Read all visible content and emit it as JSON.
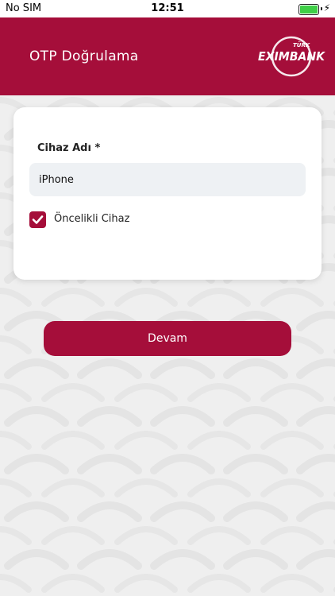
{
  "status_bar": {
    "carrier": "No SIM",
    "time": "12:51",
    "battery_icon": "battery-full-icon",
    "charging_icon": "bolt-icon"
  },
  "header": {
    "title": "OTP Doğrulama",
    "logo_text_top": "TÜRK",
    "logo_text_main": "EXIMBANK",
    "background_color": "#a50e3a"
  },
  "form": {
    "device_name_label": "Cihaz Adı *",
    "device_name_value": "iPhone",
    "priority_device_label": "Öncelikli Cihaz",
    "priority_device_checked": true
  },
  "actions": {
    "continue_label": "Devam"
  },
  "colors": {
    "accent": "#a50e3a",
    "input_bg": "#eef1f4",
    "page_bg": "#efefef"
  }
}
